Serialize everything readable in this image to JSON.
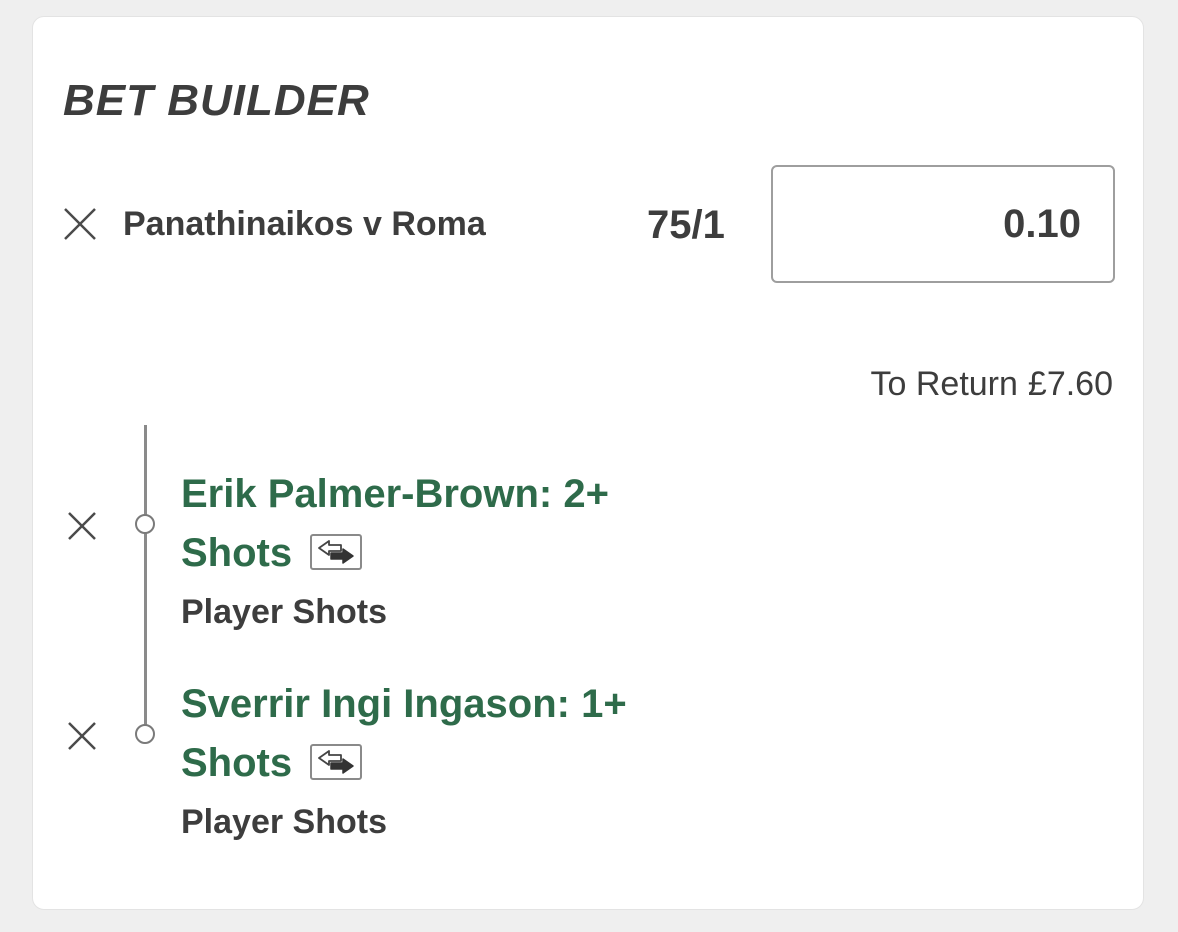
{
  "header": {
    "title": "BET BUILDER"
  },
  "bet": {
    "event_name": "Panathinaikos v Roma",
    "odds": "75/1",
    "stake": "0.10",
    "to_return_label": "To Return",
    "to_return_amount": "£7.60"
  },
  "selections": [
    {
      "name_line1": "Erik Palmer-Brown: 2+",
      "name_line2": "Shots",
      "market": "Player Shots"
    },
    {
      "name_line1": "Sverrir Ingi Ingason: 1+",
      "name_line2": "Shots",
      "market": "Player Shots"
    }
  ],
  "icons": {
    "remove": "close-icon",
    "swap": "swap-icon"
  },
  "colors": {
    "selection_green": "#2e6b4a",
    "text_dark": "#3d3d3d",
    "background": "#efefef",
    "card": "#ffffff"
  }
}
